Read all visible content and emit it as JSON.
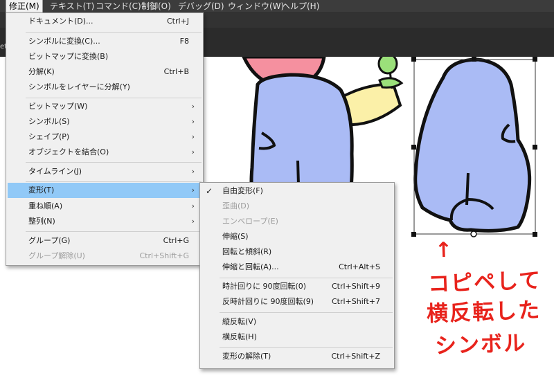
{
  "menubar": {
    "items": [
      {
        "label": "修正(M)",
        "active": true
      },
      {
        "label": "テキスト(T)"
      },
      {
        "label": "コマンド(C)"
      },
      {
        "label": "制御(O)"
      },
      {
        "label": "デバッグ(D)"
      },
      {
        "label": "ウィンドウ(W)"
      },
      {
        "label": "ヘルプ(H)"
      }
    ]
  },
  "edge_text": "et",
  "modify_menu": {
    "items": [
      {
        "label": "ドキュメント(D)...",
        "shortcut": "Ctrl+J"
      },
      {
        "label": "シンボルに変換(C)...",
        "shortcut": "F8"
      },
      {
        "label": "ビットマップに変換(B)"
      },
      {
        "label": "分解(K)",
        "shortcut": "Ctrl+B"
      },
      {
        "label": "シンボルをレイヤーに分解(Y)"
      },
      {
        "label": "ビットマップ(W)",
        "arrow": "›"
      },
      {
        "label": "シンボル(S)",
        "arrow": "›"
      },
      {
        "label": "シェイプ(P)",
        "arrow": "›"
      },
      {
        "label": "オブジェクトを結合(O)",
        "arrow": "›"
      },
      {
        "label": "タイムライン(J)",
        "arrow": "›"
      },
      {
        "label": "変形(T)",
        "arrow": "›"
      },
      {
        "label": "重ね順(A)",
        "arrow": "›"
      },
      {
        "label": "整列(N)",
        "arrow": "›"
      },
      {
        "label": "グループ(G)",
        "shortcut": "Ctrl+G"
      },
      {
        "label": "グループ解除(U)",
        "shortcut": "Ctrl+Shift+G"
      }
    ]
  },
  "transform_menu": {
    "check": "✓",
    "items": [
      {
        "label": "自由変形(F)"
      },
      {
        "label": "歪曲(D)"
      },
      {
        "label": "エンベロープ(E)"
      },
      {
        "label": "伸縮(S)"
      },
      {
        "label": "回転と傾斜(R)"
      },
      {
        "label": "伸縮と回転(A)...",
        "shortcut": "Ctrl+Alt+S"
      },
      {
        "label": "時計回りに 90度回転(0)",
        "shortcut": "Ctrl+Shift+9"
      },
      {
        "label": "反時計回りに 90度回転(9)",
        "shortcut": "Ctrl+Shift+7"
      },
      {
        "label": "縦反転(V)"
      },
      {
        "label": "横反転(H)"
      },
      {
        "label": "変形の解除(T)",
        "shortcut": "Ctrl+Shift+Z"
      }
    ]
  },
  "annotation": {
    "arrow": "↑",
    "line1": "コピペして",
    "line2": "横反転した",
    "line3": "シンボル"
  },
  "colors": {
    "highlight": "#91c9f7",
    "menubar": "#3c3c3c",
    "body_blue": "#aabbf5",
    "face_pink": "#f5909f",
    "arm_yellow": "#fbf0a8",
    "leaf_green": "#9be07a",
    "annotation_red": "#e8231c"
  }
}
